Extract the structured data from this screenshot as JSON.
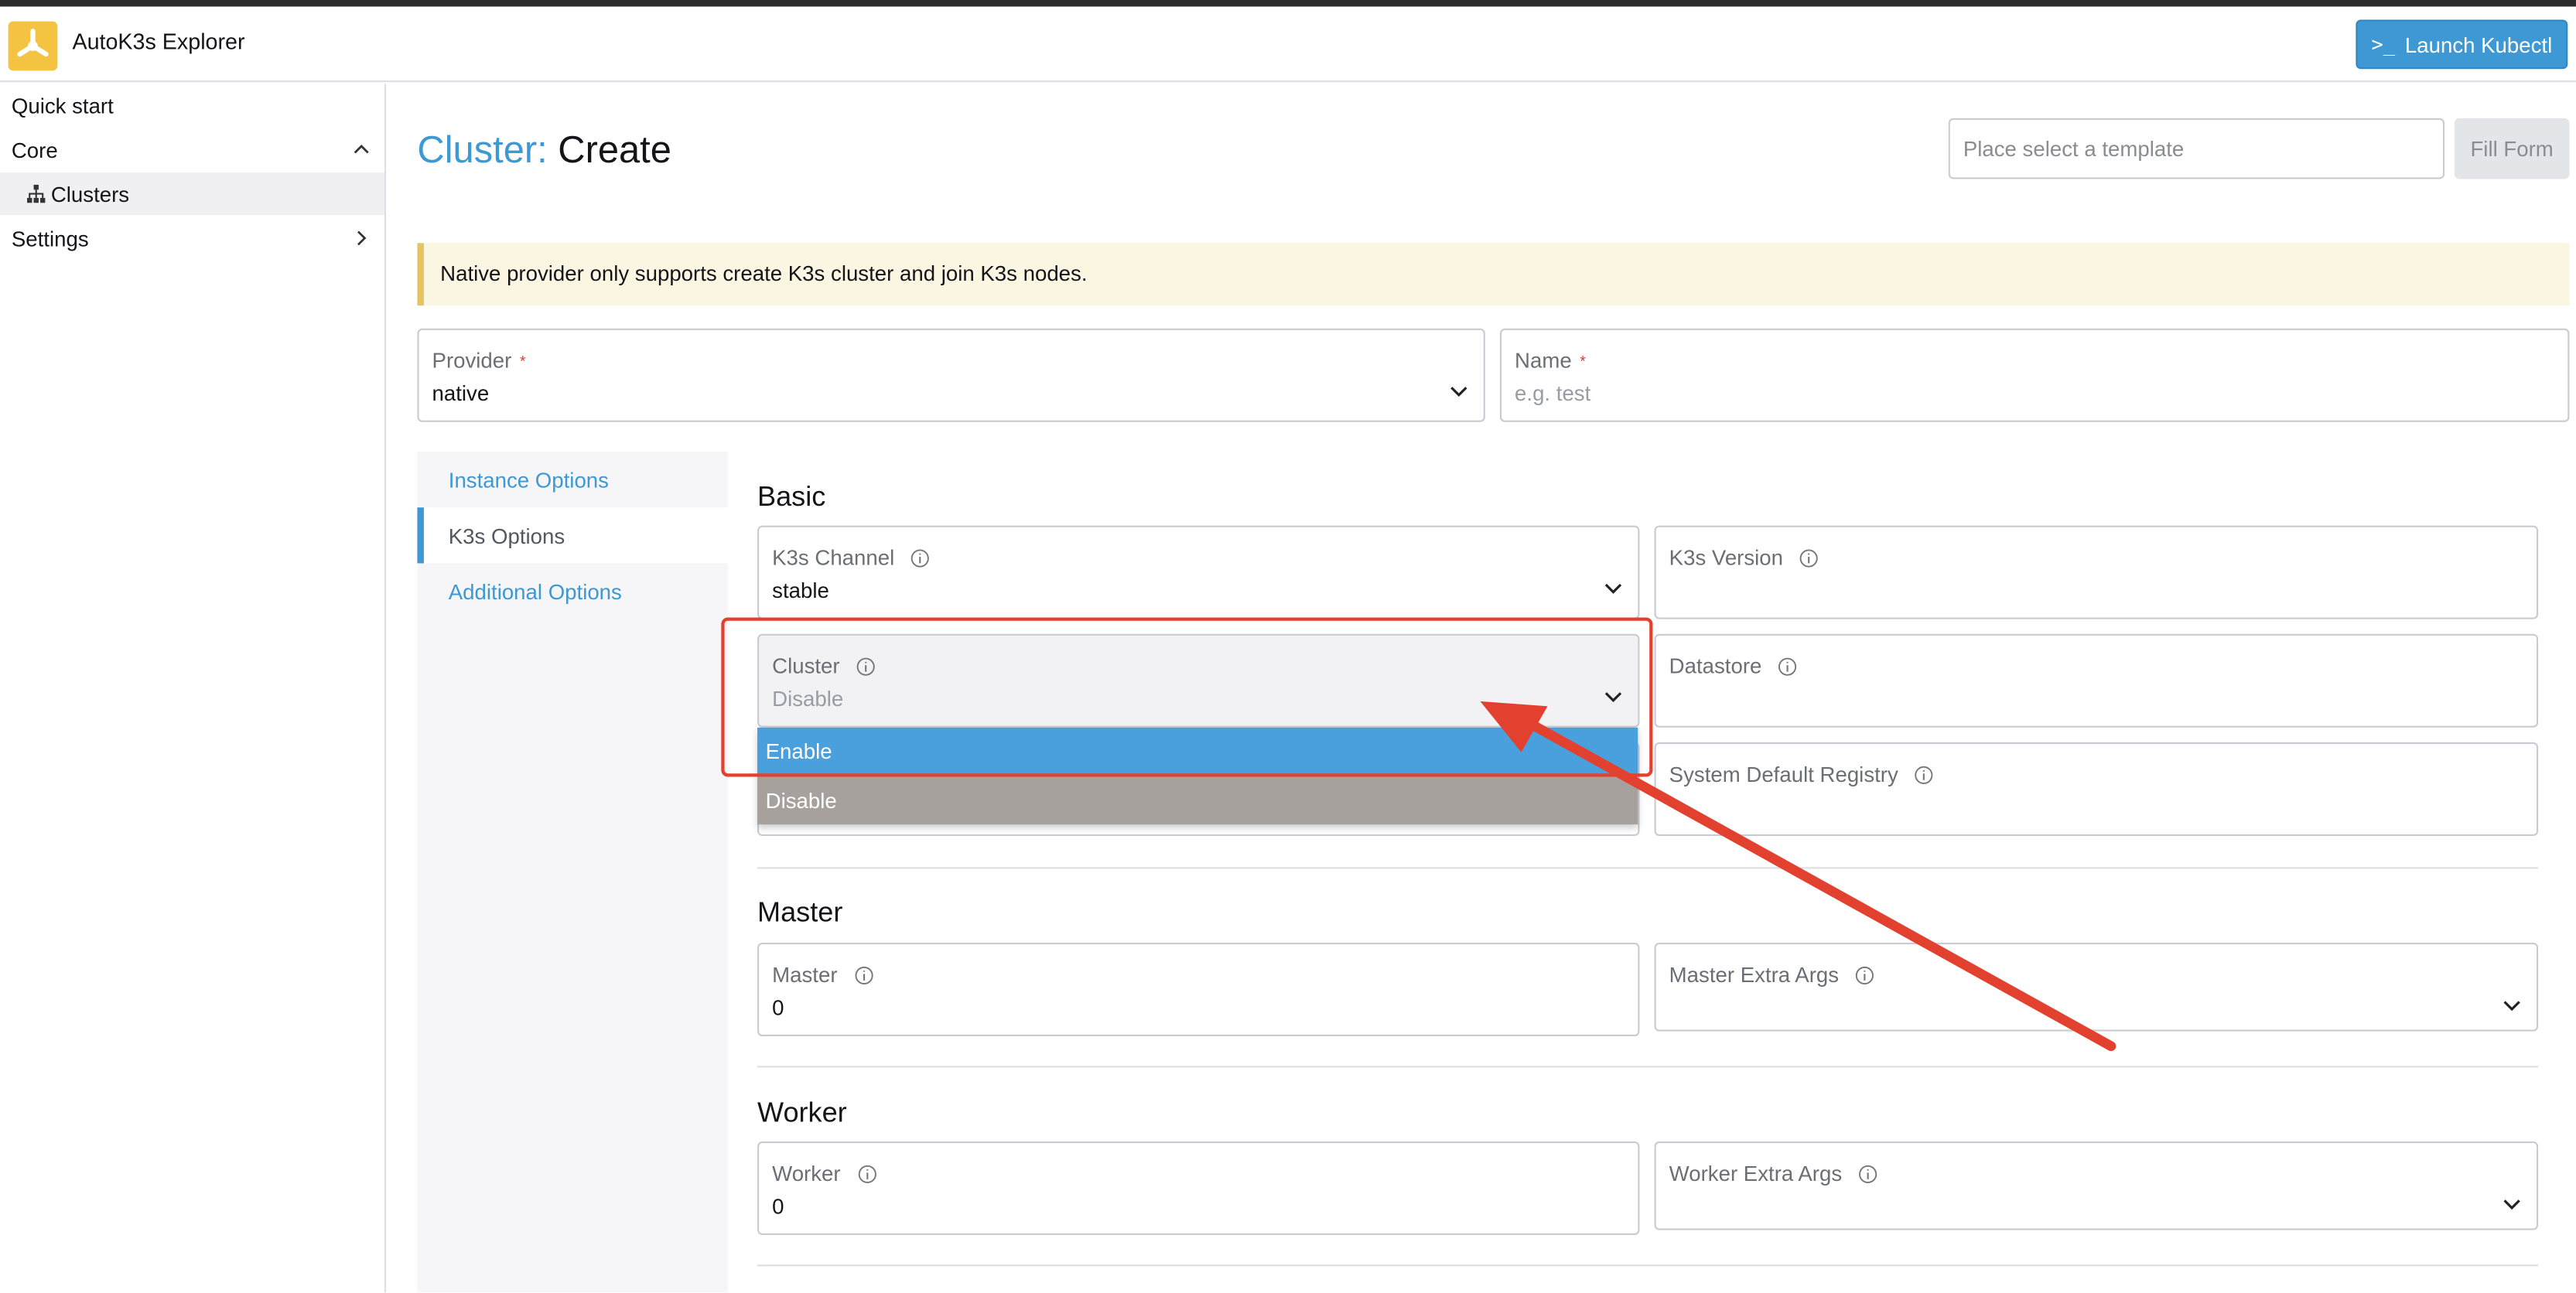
{
  "app": {
    "title": "AutoK3s Explorer",
    "launch_button": "Launch Kubectl",
    "launch_prompt": ">_"
  },
  "sidebar": {
    "items": [
      {
        "label": "Quick start"
      },
      {
        "label": "Core"
      },
      {
        "label": "Clusters"
      },
      {
        "label": "Settings"
      }
    ]
  },
  "page": {
    "title_prefix": "Cluster:",
    "title_suffix": "Create",
    "template_placeholder": "Place select a template",
    "fill_form_button": "Fill Form",
    "banner": "Native provider only supports create K3s cluster and join K3s nodes."
  },
  "top_fields": {
    "provider_label": "Provider",
    "provider_value": "native",
    "name_label": "Name",
    "name_placeholder": "e.g. test",
    "required_mark": "*"
  },
  "tabs": [
    "Instance Options",
    "K3s Options",
    "Additional Options"
  ],
  "basic": {
    "title": "Basic",
    "k3s_channel_label": "K3s Channel",
    "k3s_channel_value": "stable",
    "k3s_version_label": "K3s Version",
    "cluster_label": "Cluster",
    "cluster_value": "Disable",
    "datastore_label": "Datastore",
    "system_registry_label": "System Default Registry",
    "cluster_options": [
      "Enable",
      "Disable"
    ]
  },
  "master": {
    "title": "Master",
    "master_label": "Master",
    "master_value": "0",
    "extra_args_label": "Master Extra Args"
  },
  "worker": {
    "title": "Worker",
    "worker_label": "Worker",
    "worker_value": "0",
    "extra_args_label": "Worker Extra Args"
  },
  "colors": {
    "accent": "#3d98d3",
    "annotation": "#e2412f",
    "selected_option": "#4a9fdd",
    "logo": "#f5c342"
  }
}
